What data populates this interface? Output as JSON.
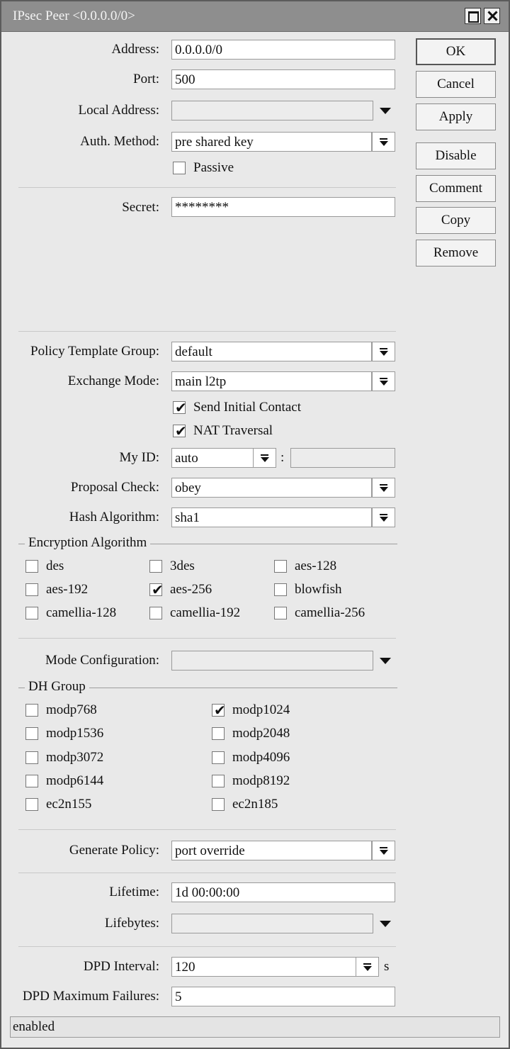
{
  "window": {
    "title": "IPsec Peer <0.0.0.0/0>"
  },
  "buttons": {
    "ok": "OK",
    "cancel": "Cancel",
    "apply": "Apply",
    "disable": "Disable",
    "comment": "Comment",
    "copy": "Copy",
    "remove": "Remove"
  },
  "fields": {
    "address": {
      "label": "Address:",
      "value": "0.0.0.0/0"
    },
    "port": {
      "label": "Port:",
      "value": "500"
    },
    "local_address": {
      "label": "Local Address:",
      "value": ""
    },
    "auth_method": {
      "label": "Auth. Method:",
      "value": "pre shared key"
    },
    "passive": {
      "label": "Passive",
      "checked": false
    },
    "secret": {
      "label": "Secret:",
      "value": "********"
    },
    "policy_template_group": {
      "label": "Policy Template Group:",
      "value": "default"
    },
    "exchange_mode": {
      "label": "Exchange Mode:",
      "value": "main l2tp"
    },
    "send_initial_contact": {
      "label": "Send Initial Contact",
      "checked": true
    },
    "nat_traversal": {
      "label": "NAT Traversal",
      "checked": true
    },
    "my_id": {
      "label": "My ID:",
      "value": "auto",
      "separator": ":",
      "extra": ""
    },
    "proposal_check": {
      "label": "Proposal Check:",
      "value": "obey"
    },
    "hash_algorithm": {
      "label": "Hash Algorithm:",
      "value": "sha1"
    },
    "mode_configuration": {
      "label": "Mode Configuration:",
      "value": ""
    },
    "generate_policy": {
      "label": "Generate Policy:",
      "value": "port override"
    },
    "lifetime": {
      "label": "Lifetime:",
      "value": "1d 00:00:00"
    },
    "lifebytes": {
      "label": "Lifebytes:",
      "value": ""
    },
    "dpd_interval": {
      "label": "DPD Interval:",
      "value": "120",
      "unit": "s"
    },
    "dpd_max_failures": {
      "label": "DPD Maximum Failures:",
      "value": "5"
    }
  },
  "encryption": {
    "title": "Encryption Algorithm",
    "options": [
      {
        "label": "des",
        "checked": false
      },
      {
        "label": "3des",
        "checked": false
      },
      {
        "label": "aes-128",
        "checked": false
      },
      {
        "label": "aes-192",
        "checked": false
      },
      {
        "label": "aes-256",
        "checked": true
      },
      {
        "label": "blowfish",
        "checked": false
      },
      {
        "label": "camellia-128",
        "checked": false
      },
      {
        "label": "camellia-192",
        "checked": false
      },
      {
        "label": "camellia-256",
        "checked": false
      }
    ]
  },
  "dh_group": {
    "title": "DH Group",
    "options": [
      {
        "label": "modp768",
        "checked": false
      },
      {
        "label": "modp1024",
        "checked": true
      },
      {
        "label": "modp1536",
        "checked": false
      },
      {
        "label": "modp2048",
        "checked": false
      },
      {
        "label": "modp3072",
        "checked": false
      },
      {
        "label": "modp4096",
        "checked": false
      },
      {
        "label": "modp6144",
        "checked": false
      },
      {
        "label": "modp8192",
        "checked": false
      },
      {
        "label": "ec2n155",
        "checked": false
      },
      {
        "label": "ec2n185",
        "checked": false
      }
    ]
  },
  "status": {
    "text": "enabled"
  },
  "icons": {
    "dropdown": "dropdown-button-icon",
    "arrow": "dropdown-arrow-icon",
    "check": "checkmark-icon",
    "maximize": "maximize-icon",
    "close": "close-icon"
  }
}
